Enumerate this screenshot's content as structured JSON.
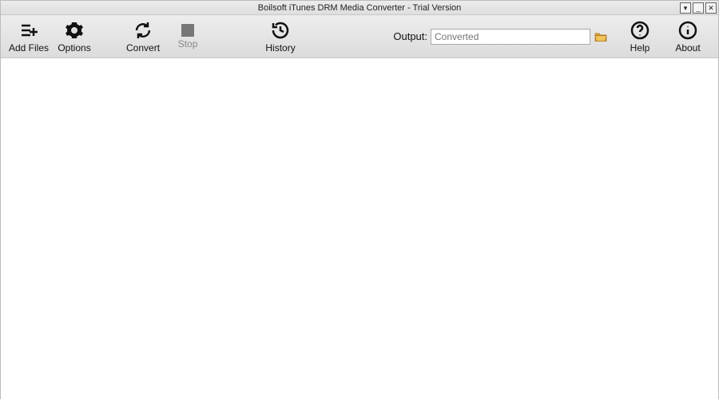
{
  "window": {
    "title": "Boilsoft iTunes DRM Media Converter - Trial Version"
  },
  "windowControls": {
    "menu": "▾",
    "minimize": "_",
    "close": "✕"
  },
  "toolbar": {
    "addFiles": {
      "label": "Add Files"
    },
    "options": {
      "label": "Options"
    },
    "convert": {
      "label": "Convert"
    },
    "stop": {
      "label": "Stop"
    },
    "history": {
      "label": "History"
    },
    "help": {
      "label": "Help"
    },
    "about": {
      "label": "About"
    }
  },
  "output": {
    "label": "Output:",
    "placeholder": "Converted",
    "value": ""
  }
}
